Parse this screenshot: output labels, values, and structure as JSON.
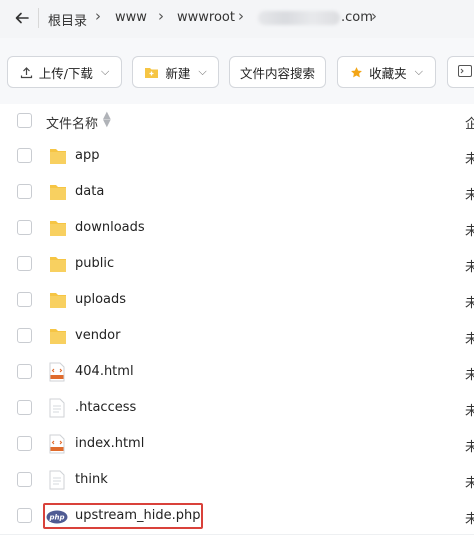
{
  "breadcrumb": {
    "items": [
      "根目录",
      "www",
      "wwwroot"
    ],
    "domain_suffix": "com"
  },
  "toolbar": {
    "upload_label": "上传/下载",
    "new_label": "新建",
    "search_label": "文件内容搜索",
    "favorites_label": "收藏夹"
  },
  "table": {
    "header_name": "文件名称",
    "header_right": "企",
    "right_col_char": "未",
    "rows": [
      {
        "name": "app",
        "type": "folder"
      },
      {
        "name": "data",
        "type": "folder"
      },
      {
        "name": "downloads",
        "type": "folder"
      },
      {
        "name": "public",
        "type": "folder"
      },
      {
        "name": "uploads",
        "type": "folder"
      },
      {
        "name": "vendor",
        "type": "folder"
      },
      {
        "name": "404.html",
        "type": "html"
      },
      {
        "name": ".htaccess",
        "type": "text"
      },
      {
        "name": "index.html",
        "type": "html"
      },
      {
        "name": "think",
        "type": "text"
      },
      {
        "name": "upstream_hide.php",
        "type": "php"
      }
    ]
  },
  "icons": {
    "back": "arrow-left-icon",
    "upload": "upload-icon",
    "new": "new-folder-icon",
    "favorites": "star-icon",
    "terminal": "terminal-icon"
  },
  "colors": {
    "folder": "#f6c544",
    "highlight": "#d9413a",
    "star": "#f2a516"
  }
}
